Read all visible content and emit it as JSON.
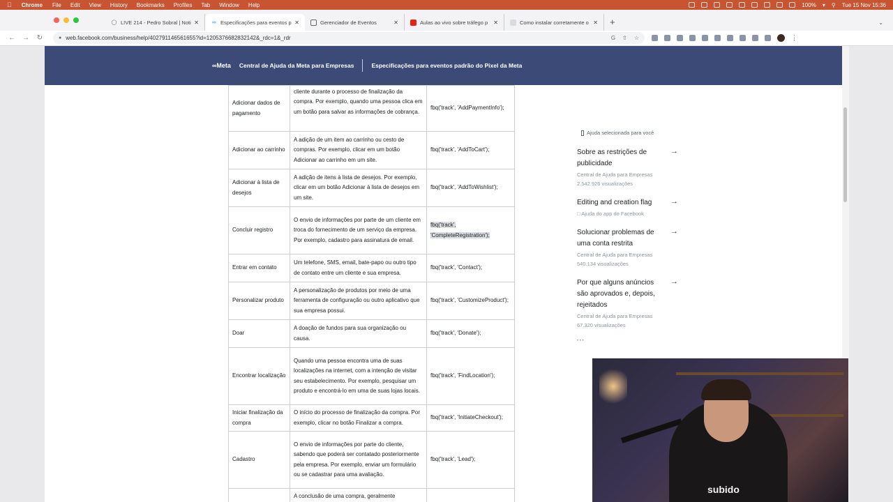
{
  "menubar": {
    "app": "Chrome",
    "items": [
      "File",
      "Edit",
      "View",
      "History",
      "Bookmarks",
      "Profiles",
      "Tab",
      "Window",
      "Help"
    ],
    "battery": "100%",
    "datetime": "Tue 15 Nov  15:36",
    "color": "#c95432"
  },
  "tabs": [
    {
      "title": "LIVE 214 - Pedro Sobral | Noti",
      "icon": "notion-icon"
    },
    {
      "title": "Especificações para eventos p",
      "icon": "meta-icon"
    },
    {
      "title": "Gerenciador de Eventos",
      "icon": "events-manager-icon"
    },
    {
      "title": "Aulas ao vivo sobre tráfego p",
      "icon": "youtube-icon"
    },
    {
      "title": "Como instalar corretamente o",
      "icon": "page-icon"
    }
  ],
  "toolbar": {
    "url": "web.facebook.com/business/help/402791146561655?id=1205376682832142&_rdc=1&_rdr"
  },
  "header": {
    "logo": "∞Meta",
    "help_center": "Central de Ajuda da Meta para Empresas",
    "page_title": "Especificações para eventos padrão do Pixel da Meta",
    "color": "#3b4a77"
  },
  "table": {
    "rows": [
      {
        "name": "Adicionar dados de pagamento",
        "desc": "cliente durante o processo de finalização da compra. Por exemplo, quando uma pessoa clica em um botão para salvar as informações de cobrança.",
        "code": "fbq('track', 'AddPaymentInfo');"
      },
      {
        "name": "Adicionar ao carrinho",
        "desc": "A adição de um item ao carrinho ou cesto de compras. Por exemplo, clicar em um botão Adicionar ao carrinho em um site.",
        "code": "fbq('track', 'AddToCart');"
      },
      {
        "name": "Adicionar à lista de desejos",
        "desc": "A adição de itens à lista de desejos. Por exemplo, clicar em um botão Adicionar à lista de desejos em um site.",
        "code": "fbq('track', 'AddToWishlist');"
      },
      {
        "name": "Concluir registro",
        "desc": "O envio de informações por parte de um cliente em troca do fornecimento de um serviço da empresa. Por exemplo, cadastro para assinatura de email.",
        "code": "fbq('track', 'CompleteRegistration');"
      },
      {
        "name": "Entrar em contato",
        "desc": "Um telefone, SMS, email, bate-papo ou outro tipo de contato entre um cliente e sua empresa.",
        "code": "fbq('track', 'Contact');"
      },
      {
        "name": "Personalizar produto",
        "desc": "A personalização de produtos por meio de uma ferramenta de configuração ou outro aplicativo que sua empresa possui.",
        "code": "fbq('track', 'CustomizeProduct');"
      },
      {
        "name": "Doar",
        "desc": "A doação de fundos para sua organização ou causa.",
        "code": "fbq('track', 'Donate');"
      },
      {
        "name": "Encontrar localização",
        "desc": "Quando uma pessoa encontra uma de suas localizações na internet, com a intenção de visitar seu estabelecimento. Por exemplo, pesquisar um produto e encontrá-lo em uma de suas lojas locais.",
        "code": "fbq('track', 'FindLocation');"
      },
      {
        "name": "Iniciar finalização da compra",
        "desc": "O início do processo de finalização da compra. Por exemplo, clicar no botão Finalizar a compra.",
        "code": "fbq('track', 'InitiateCheckout');"
      },
      {
        "name": "Cadastro",
        "desc": "O envio de informações por parte do cliente, sabendo que poderá ser contatado posteriormente pela empresa. Por exemplo, enviar um formulário ou se cadastrar para uma avaliação.",
        "code": "fbq('track', 'Lead');"
      },
      {
        "name": "",
        "desc": "A conclusão de uma compra, geralmente",
        "code": ""
      }
    ]
  },
  "sidebar": {
    "heading": "Ajuda selecionada para você",
    "articles": [
      {
        "title": "Sobre as restrições de publicidade",
        "meta": "Central de Ajuda para Empresas",
        "views": "2.542.926 visualizações"
      },
      {
        "title": "Editing and creation flag",
        "meta": "Ajuda do app do Facebook",
        "views": ""
      },
      {
        "title": "Solucionar problemas de uma conta restrita",
        "meta": "Central de Ajuda para Empresas",
        "views": "540.134 visualizações"
      },
      {
        "title": "Por que alguns anúncios são aprovados e, depois, rejeitados",
        "meta": "Central de Ajuda para Empresas",
        "views": "67.320 visualizações"
      }
    ],
    "pager": "• • •"
  },
  "webcam": {
    "shirt_text": "subido"
  }
}
